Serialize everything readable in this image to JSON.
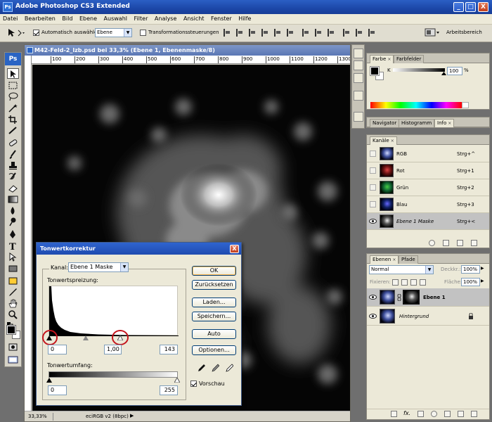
{
  "window": {
    "title": "Adobe Photoshop CS3 Extended",
    "logo": "Ps",
    "controls": {
      "minimize": "_",
      "maximize": "□",
      "close": "X"
    }
  },
  "menu": [
    "Datei",
    "Bearbeiten",
    "Bild",
    "Ebene",
    "Auswahl",
    "Filter",
    "Analyse",
    "Ansicht",
    "Fenster",
    "Hilfe"
  ],
  "options": {
    "auto_select_label": "Automatisch auswählen:",
    "auto_select_value": "Ebene",
    "transform_label": "Transformationssteuerungen",
    "workspace_label": "Arbeitsbereich"
  },
  "document": {
    "title": "M42-Feld-2_lzb.psd bei 33,3% (Ebene 1, Ebenenmaske/8)",
    "ruler_ticks": [
      "100",
      "200",
      "300",
      "400",
      "500",
      "600",
      "700",
      "800",
      "900",
      "1000",
      "1100",
      "1200",
      "1300"
    ],
    "zoom": "33,33%",
    "profile": "eciRGB v2 (8bpc)"
  },
  "dialog": {
    "title": "Tonwertkorrektur",
    "close": "X",
    "channel_label": "Kanal:",
    "channel_value": "Ebene 1 Maske",
    "input_levels_label": "Tonwertspreizung:",
    "input_black": "0",
    "input_gamma": "1,00",
    "input_white": "143",
    "output_levels_label": "Tonwertumfang:",
    "output_black": "0",
    "output_white": "255",
    "buttons": {
      "ok": "OK",
      "reset": "Zurücksetzen",
      "load": "Laden...",
      "save": "Speichern...",
      "auto": "Auto",
      "options": "Optionen..."
    },
    "preview_label": "Vorschau",
    "preview_checked": true
  },
  "color_panel": {
    "tabs": [
      "Farbe",
      "Farbfelder"
    ],
    "channel_label": "K",
    "value": "100",
    "unit": "%"
  },
  "info_panel": {
    "tabs": [
      "Navigator",
      "Histogramm",
      "Info"
    ]
  },
  "channels_panel": {
    "tab": "Kanäle",
    "rows": [
      {
        "name": "RGB",
        "shortcut": "Strg+^"
      },
      {
        "name": "Rot",
        "shortcut": "Strg+1"
      },
      {
        "name": "Grün",
        "shortcut": "Strg+2"
      },
      {
        "name": "Blau",
        "shortcut": "Strg+3"
      },
      {
        "name": "Ebene 1 Maske",
        "shortcut": "Strg+<"
      }
    ]
  },
  "layers_panel": {
    "tabs": [
      "Ebenen",
      "Pfade"
    ],
    "blend_mode": "Normal",
    "opacity_label": "Deckkr.:",
    "opacity_value": "100%",
    "lock_label": "Fixieren:",
    "fill_label": "Fläche:",
    "fill_value": "100%",
    "layers": [
      {
        "name": "Ebene 1"
      },
      {
        "name": "Hintergrund"
      }
    ]
  }
}
